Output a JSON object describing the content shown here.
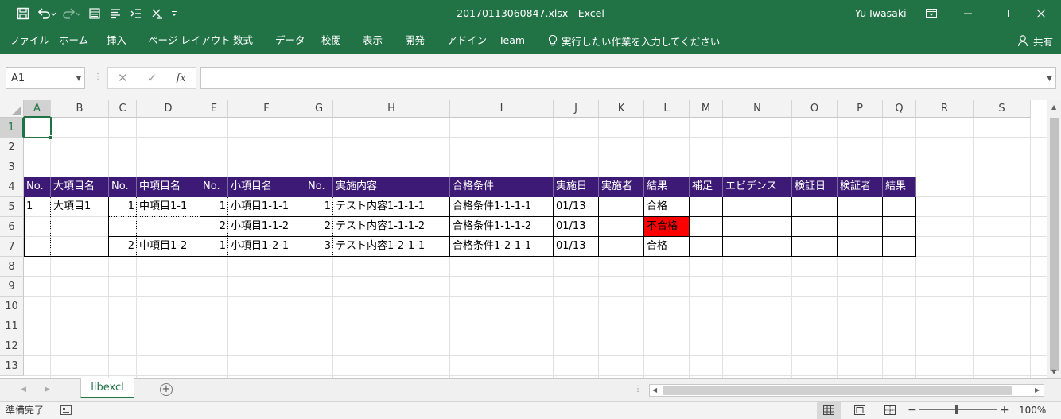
{
  "app": {
    "title": "20170113060847.xlsx  -  Excel",
    "user": "Yu Iwasaki",
    "share": "共有"
  },
  "ribbon": {
    "tabs": [
      "ファイル",
      "ホーム",
      "挿入",
      "ページ レイアウト",
      "数式",
      "データ",
      "校閲",
      "表示",
      "開発",
      "アドイン",
      "Team"
    ],
    "tellme": "実行したい作業を入力してください"
  },
  "formula_bar": {
    "name_box": "A1",
    "formula": ""
  },
  "columns": [
    "A",
    "B",
    "C",
    "D",
    "E",
    "F",
    "G",
    "H",
    "I",
    "J",
    "K",
    "L",
    "M",
    "N",
    "O",
    "P",
    "Q",
    "R",
    "S"
  ],
  "rows": [
    "1",
    "2",
    "3",
    "4",
    "5",
    "6",
    "7",
    "8",
    "9",
    "10",
    "11",
    "12",
    "13"
  ],
  "table": {
    "header": [
      "No.",
      "大項目名",
      "No.",
      "中項目名",
      "No.",
      "小項目名",
      "No.",
      "実施内容",
      "合格条件",
      "実施日",
      "実施者",
      "結果",
      "補足",
      "エビデンス",
      "検証日",
      "検証者",
      "結果"
    ],
    "cells": [
      {
        "row": 5,
        "col": "A",
        "value": "1"
      },
      {
        "row": 5,
        "col": "B",
        "value": "大項目1"
      },
      {
        "row": 5,
        "col": "C",
        "value": "1",
        "align": "right"
      },
      {
        "row": 5,
        "col": "D",
        "value": "中項目1-1"
      },
      {
        "row": 5,
        "col": "E",
        "value": "1",
        "align": "right"
      },
      {
        "row": 5,
        "col": "F",
        "value": "小項目1-1-1"
      },
      {
        "row": 5,
        "col": "G",
        "value": "1",
        "align": "right"
      },
      {
        "row": 5,
        "col": "H",
        "value": "テスト内容1-1-1-1"
      },
      {
        "row": 5,
        "col": "I",
        "value": "合格条件1-1-1-1"
      },
      {
        "row": 5,
        "col": "J",
        "value": "01/13"
      },
      {
        "row": 5,
        "col": "L",
        "value": "合格"
      },
      {
        "row": 6,
        "col": "E",
        "value": "2",
        "align": "right"
      },
      {
        "row": 6,
        "col": "F",
        "value": "小項目1-1-2"
      },
      {
        "row": 6,
        "col": "G",
        "value": "2",
        "align": "right"
      },
      {
        "row": 6,
        "col": "H",
        "value": "テスト内容1-1-1-2"
      },
      {
        "row": 6,
        "col": "I",
        "value": "合格条件1-1-1-2"
      },
      {
        "row": 6,
        "col": "J",
        "value": "01/13"
      },
      {
        "row": 6,
        "col": "L",
        "value": "不合格",
        "fill": "#ff0000"
      },
      {
        "row": 7,
        "col": "C",
        "value": "2",
        "align": "right"
      },
      {
        "row": 7,
        "col": "D",
        "value": "中項目1-2"
      },
      {
        "row": 7,
        "col": "E",
        "value": "1",
        "align": "right"
      },
      {
        "row": 7,
        "col": "F",
        "value": "小項目1-2-1"
      },
      {
        "row": 7,
        "col": "G",
        "value": "3",
        "align": "right"
      },
      {
        "row": 7,
        "col": "H",
        "value": "テスト内容1-2-1-1"
      },
      {
        "row": 7,
        "col": "I",
        "value": "合格条件1-2-1-1"
      },
      {
        "row": 7,
        "col": "J",
        "value": "01/13"
      },
      {
        "row": 7,
        "col": "L",
        "value": "合格"
      }
    ]
  },
  "sheets": {
    "tabs": [
      "libexcl"
    ],
    "active": "libexcl"
  },
  "status": {
    "text": "準備完了",
    "zoom": "100%"
  },
  "colors": {
    "excel_green": "#217346",
    "header_fill": "#3d1a75",
    "fail_fill": "#ff0000"
  }
}
